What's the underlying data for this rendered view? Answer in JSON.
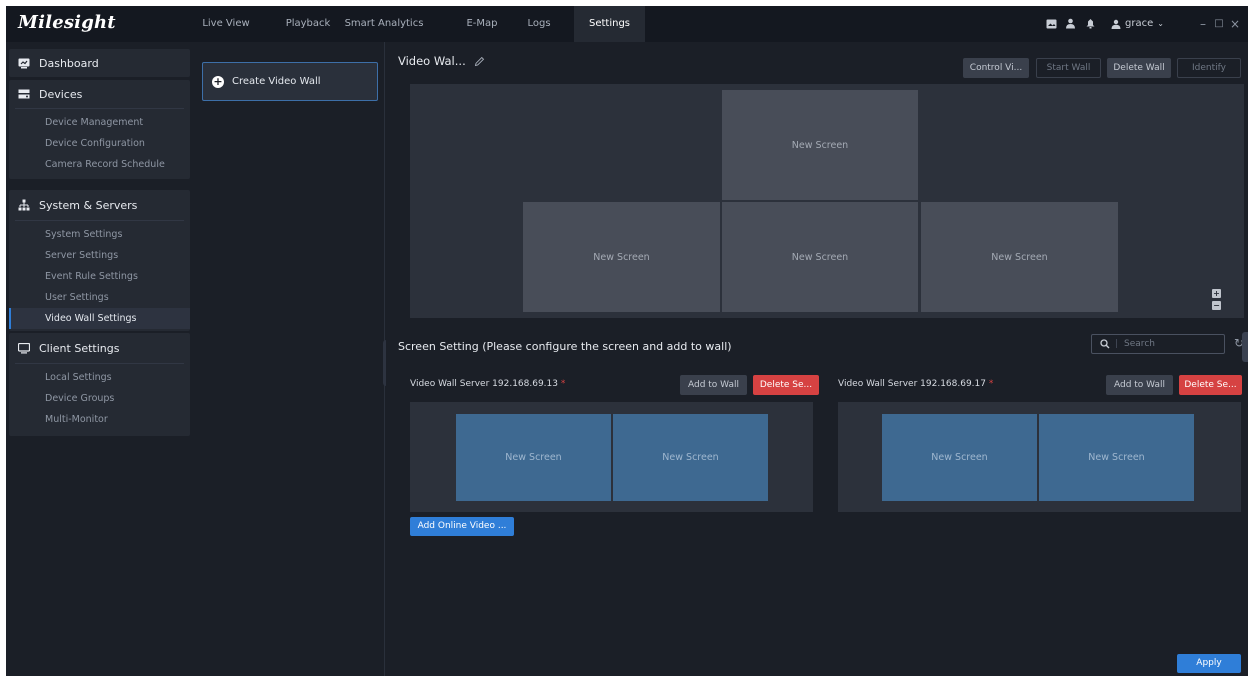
{
  "app": {
    "logo": "Milesight",
    "tabs": [
      "Live View",
      "Playback",
      "Smart Analytics",
      "E-Map",
      "Logs",
      "Settings"
    ],
    "active_tab": "Settings",
    "user": "grace",
    "accent": "#2f7ed8"
  },
  "sidebar": {
    "dashboard": "Dashboard",
    "devices": {
      "title": "Devices",
      "items": [
        "Device Management",
        "Device Configuration",
        "Camera Record Schedule"
      ]
    },
    "system": {
      "title": "System & Servers",
      "items": [
        "System Settings",
        "Server Settings",
        "Event Rule Settings",
        "User Settings",
        "Video Wall Settings"
      ]
    },
    "client": {
      "title": "Client Settings",
      "items": [
        "Local Settings",
        "Device Groups",
        "Multi-Monitor"
      ]
    }
  },
  "middle": {
    "create_label": "Create Video Wall"
  },
  "wall": {
    "title": "Video Wal...",
    "buttons": {
      "control": "Control Vi...",
      "start": "Start Wall",
      "delete": "Delete Wall",
      "identify": "Identify"
    },
    "screens": [
      "New Screen",
      "New Screen",
      "New Screen",
      "New Screen"
    ]
  },
  "screen_setting": {
    "title": "Screen Setting  (Please configure the screen and add to wall)",
    "search_placeholder": "Search",
    "servers": [
      {
        "label": "Video Wall Server 192.168.69.13",
        "add": "Add to Wall",
        "delete": "Delete Se...",
        "screens": [
          "New Screen",
          "New Screen"
        ]
      },
      {
        "label": "Video Wall Server 192.168.69.17",
        "add": "Add to Wall",
        "delete": "Delete Se...",
        "screens": [
          "New Screen",
          "New Screen"
        ]
      }
    ],
    "add_online": "Add Online Video ..."
  },
  "footer": {
    "apply": "Apply"
  }
}
